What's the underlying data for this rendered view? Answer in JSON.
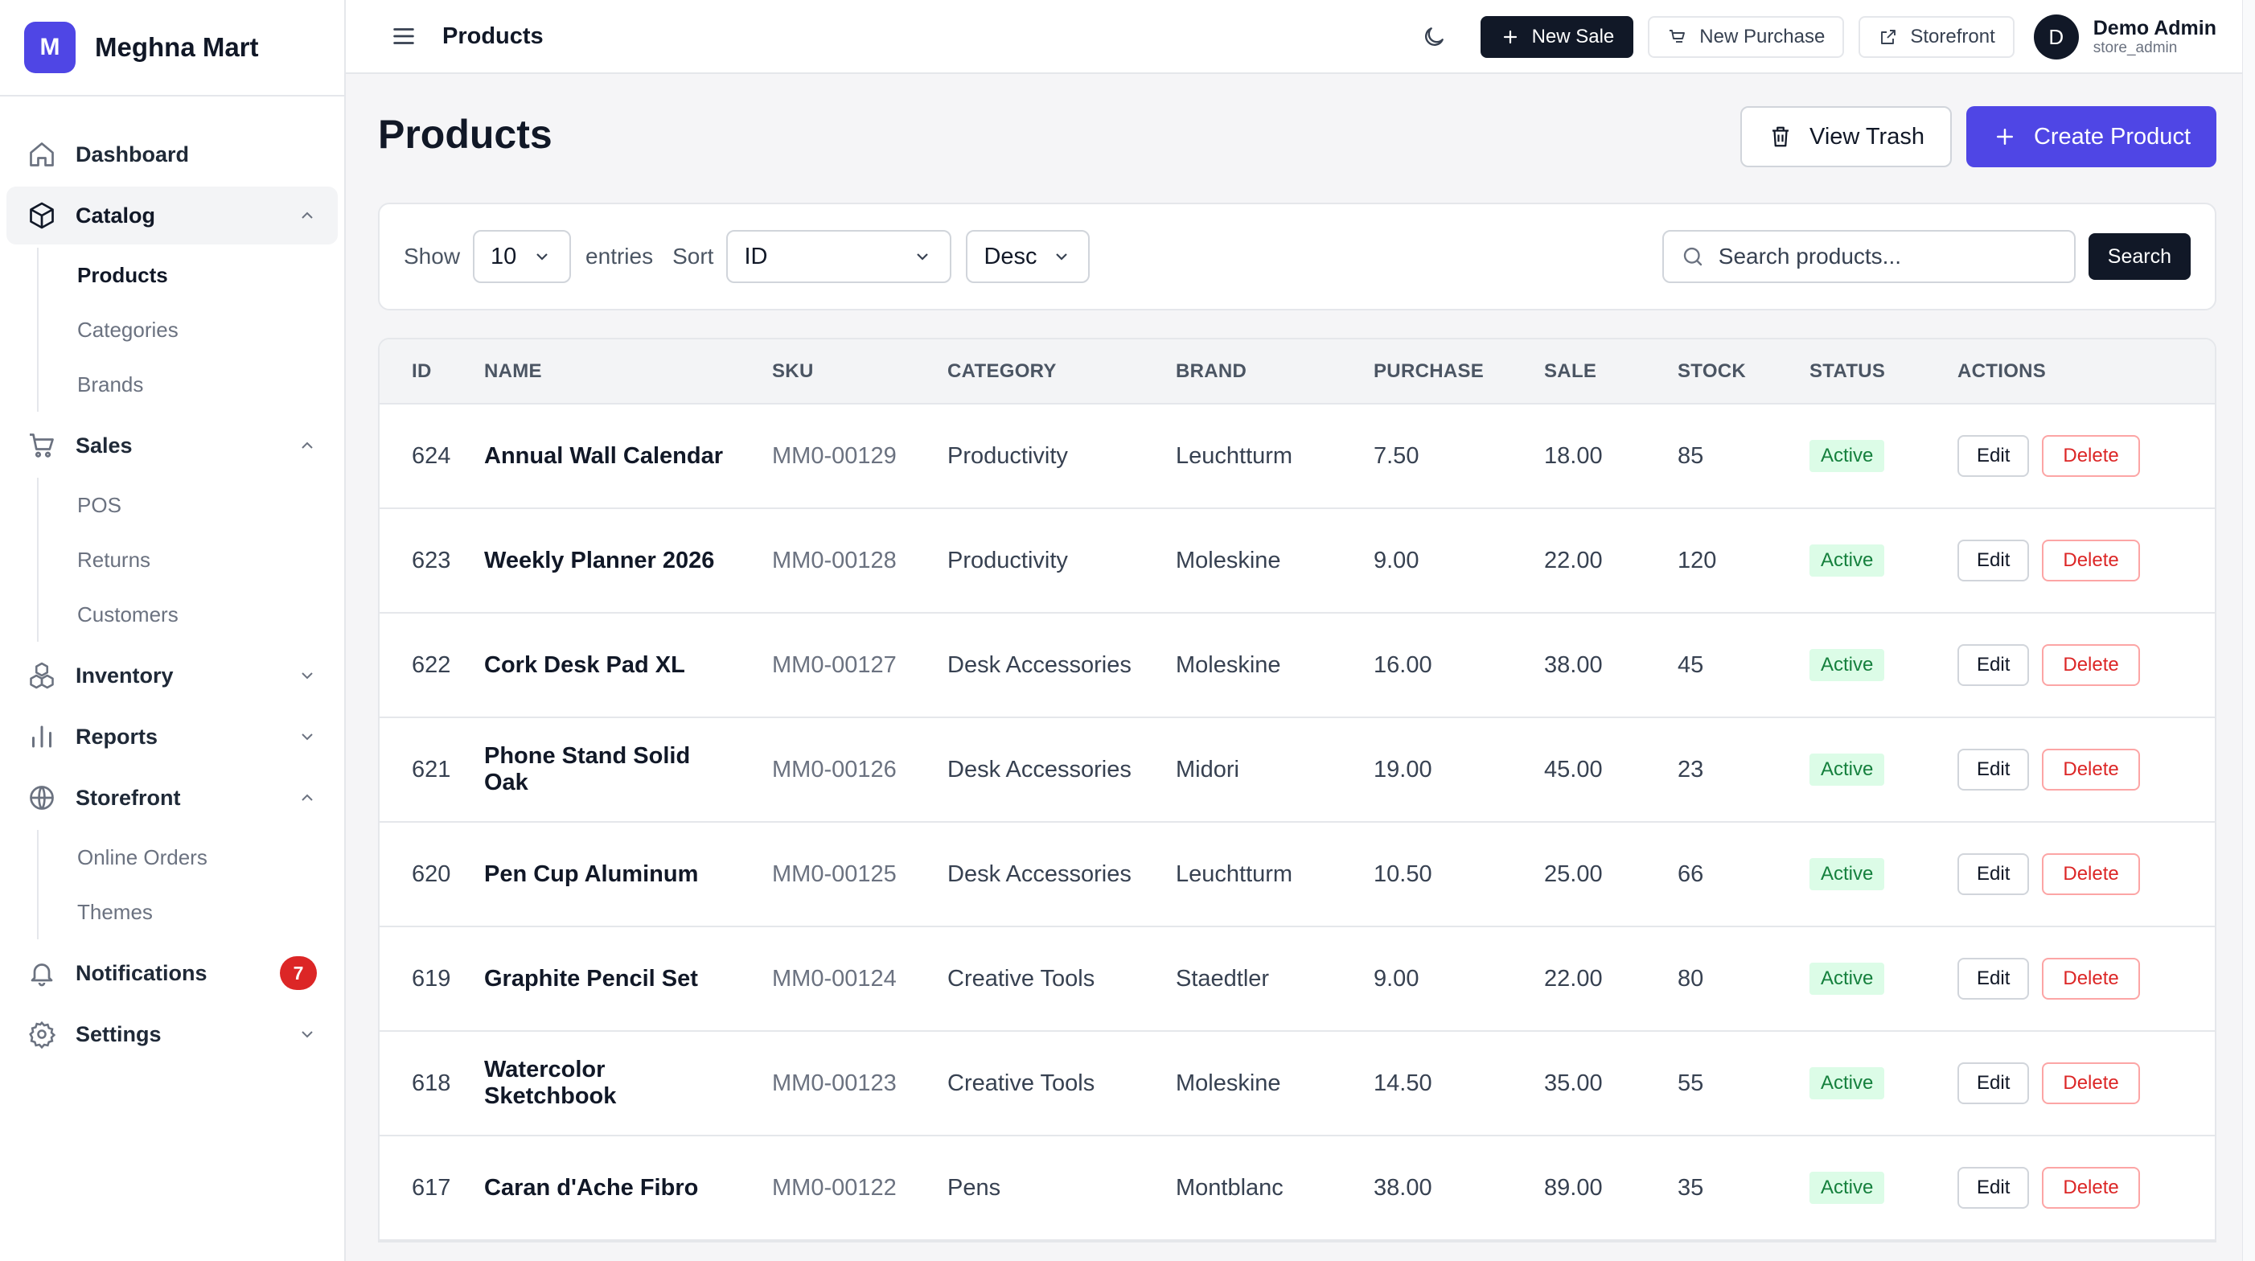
{
  "brand": {
    "logo_letter": "M",
    "name": "Meghna Mart",
    "accent": "#4f46e5"
  },
  "sidebar": {
    "items": [
      {
        "label": "Dashboard",
        "icon": "home-icon"
      },
      {
        "label": "Catalog",
        "icon": "box-icon",
        "expanded": true,
        "children": [
          "Products",
          "Categories",
          "Brands"
        ],
        "active_child": "Products"
      },
      {
        "label": "Sales",
        "icon": "cart-icon",
        "expanded": true,
        "children": [
          "POS",
          "Returns",
          "Customers"
        ]
      },
      {
        "label": "Inventory",
        "icon": "boxes-icon",
        "expanded": false
      },
      {
        "label": "Reports",
        "icon": "bar-chart-icon",
        "expanded": false
      },
      {
        "label": "Storefront",
        "icon": "globe-icon",
        "expanded": true,
        "children": [
          "Online Orders",
          "Themes"
        ]
      },
      {
        "label": "Notifications",
        "icon": "bell-icon",
        "badge": "7"
      },
      {
        "label": "Settings",
        "icon": "gear-icon",
        "expanded": false
      }
    ]
  },
  "topbar": {
    "title": "Products",
    "new_sale": "New Sale",
    "new_purchase": "New Purchase",
    "storefront": "Storefront",
    "user": {
      "initial": "D",
      "name": "Demo Admin",
      "role": "store_admin"
    }
  },
  "page": {
    "title": "Products",
    "view_trash": "View Trash",
    "create_product": "Create Product"
  },
  "filters": {
    "show_label": "Show",
    "entries_value": "10",
    "entries_label": "entries",
    "sort_label": "Sort",
    "sort_value": "ID",
    "order_value": "Desc",
    "search_placeholder": "Search products...",
    "search_button": "Search"
  },
  "table": {
    "headers": [
      "ID",
      "NAME",
      "SKU",
      "CATEGORY",
      "BRAND",
      "PURCHASE",
      "SALE",
      "STOCK",
      "STATUS",
      "ACTIONS"
    ],
    "edit_label": "Edit",
    "delete_label": "Delete",
    "rows": [
      {
        "id": "624",
        "name": "Annual Wall Calendar",
        "sku": "MM0-00129",
        "category": "Productivity",
        "brand": "Leuchtturm",
        "purchase": "7.50",
        "sale": "18.00",
        "stock": "85",
        "status": "Active"
      },
      {
        "id": "623",
        "name": "Weekly Planner 2026",
        "sku": "MM0-00128",
        "category": "Productivity",
        "brand": "Moleskine",
        "purchase": "9.00",
        "sale": "22.00",
        "stock": "120",
        "status": "Active"
      },
      {
        "id": "622",
        "name": "Cork Desk Pad XL",
        "sku": "MM0-00127",
        "category": "Desk Accessories",
        "brand": "Moleskine",
        "purchase": "16.00",
        "sale": "38.00",
        "stock": "45",
        "status": "Active"
      },
      {
        "id": "621",
        "name": "Phone Stand Solid Oak",
        "sku": "MM0-00126",
        "category": "Desk Accessories",
        "brand": "Midori",
        "purchase": "19.00",
        "sale": "45.00",
        "stock": "23",
        "status": "Active"
      },
      {
        "id": "620",
        "name": "Pen Cup Aluminum",
        "sku": "MM0-00125",
        "category": "Desk Accessories",
        "brand": "Leuchtturm",
        "purchase": "10.50",
        "sale": "25.00",
        "stock": "66",
        "status": "Active"
      },
      {
        "id": "619",
        "name": "Graphite Pencil Set",
        "sku": "MM0-00124",
        "category": "Creative Tools",
        "brand": "Staedtler",
        "purchase": "9.00",
        "sale": "22.00",
        "stock": "80",
        "status": "Active"
      },
      {
        "id": "618",
        "name": "Watercolor Sketchbook",
        "sku": "MM0-00123",
        "category": "Creative Tools",
        "brand": "Moleskine",
        "purchase": "14.50",
        "sale": "35.00",
        "stock": "55",
        "status": "Active"
      },
      {
        "id": "617",
        "name": "Caran d'Ache Fibro",
        "sku": "MM0-00122",
        "category": "Pens",
        "brand": "Montblanc",
        "purchase": "38.00",
        "sale": "89.00",
        "stock": "35",
        "status": "Active"
      }
    ]
  }
}
